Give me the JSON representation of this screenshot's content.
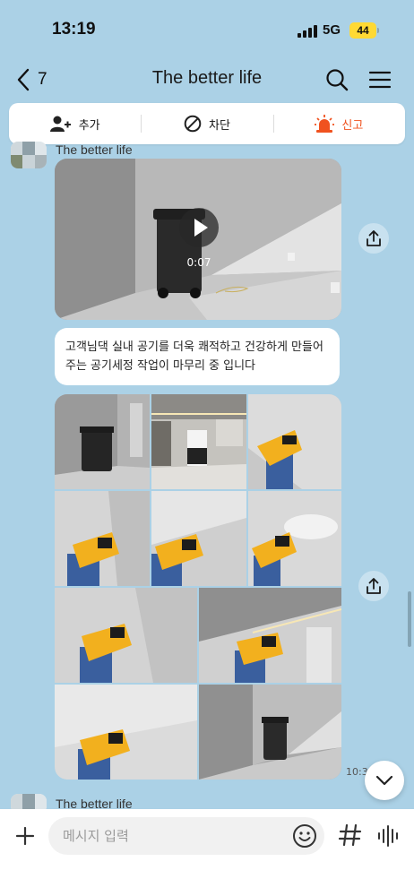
{
  "status_bar": {
    "time": "13:19",
    "network": "5G",
    "battery": "44"
  },
  "header": {
    "back_count": "7",
    "title": "The better life",
    "icons": [
      "back-chevron-icon",
      "search-icon",
      "menu-icon"
    ]
  },
  "action_bar": {
    "items": [
      {
        "label": "추가",
        "icon": "add-friend-icon"
      },
      {
        "label": "차단",
        "icon": "block-icon"
      },
      {
        "label": "신고",
        "icon": "siren-icon"
      }
    ],
    "report_color": "#f0521f"
  },
  "messages": {
    "sender_name": "The better life",
    "video": {
      "duration": "0:07"
    },
    "text": "고객님댁 실내 공기를 더욱 쾌적하고 건강하게 만들어 주는 공기세정 작업이 마무리 중 입니다",
    "photo_count": 11,
    "time": "10:3",
    "next_sender_name": "The better life"
  },
  "input": {
    "placeholder": "메시지 입력"
  },
  "colors": {
    "chat_background": "#abd1e6",
    "bubble": "#ffffff",
    "battery": "#ffd934"
  }
}
